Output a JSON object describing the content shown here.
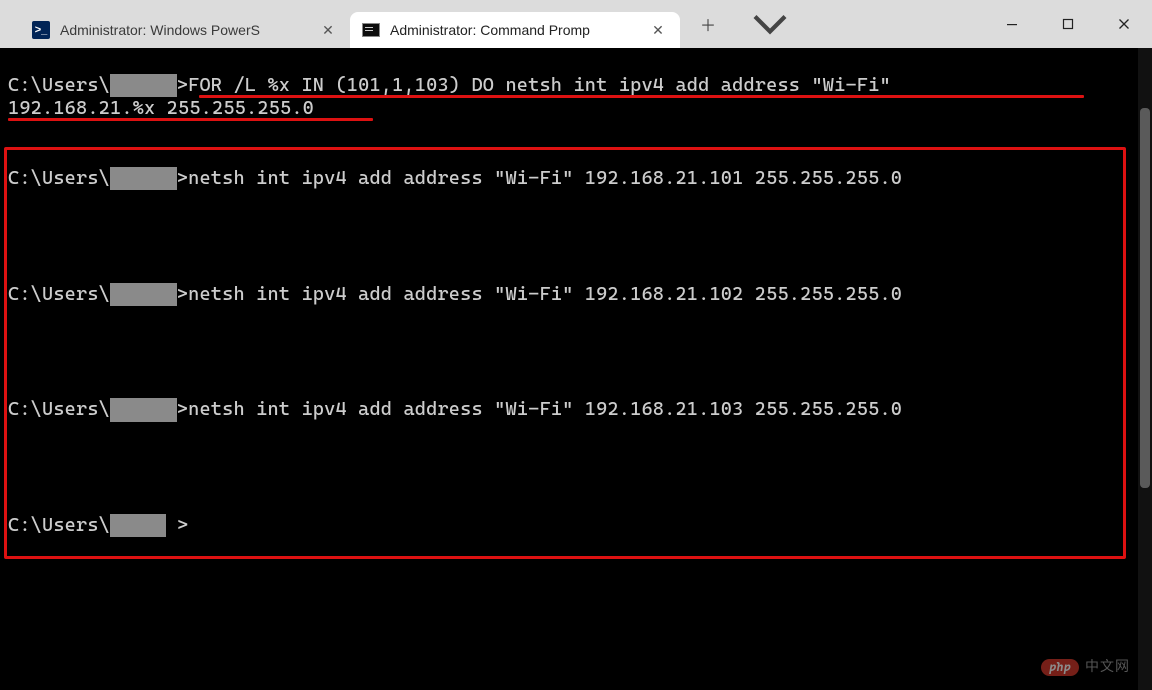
{
  "tabs": [
    {
      "title": "Administrator: Windows PowerS",
      "icon": "powershell",
      "active": false
    },
    {
      "title": "Administrator: Command Promp",
      "icon": "cmd",
      "active": true
    }
  ],
  "prompt_path": "C:\\Users\\",
  "prompt_redacted_len": 6,
  "prompt_suffix": ">",
  "main_command_line1": "FOR /L %x IN (101,1,103) DO netsh int ipv4 add address \"Wi-Fi\"",
  "main_command_line2": "192.168.21.%x 255.255.255.0",
  "iterations": [
    "netsh int ipv4 add address \"Wi-Fi\" 192.168.21.101 255.255.255.0",
    "netsh int ipv4 add address \"Wi-Fi\" 192.168.21.102 255.255.255.0",
    "netsh int ipv4 add address \"Wi-Fi\" 192.168.21.103 255.255.255.0"
  ],
  "watermark": {
    "badge": "php",
    "text": "中文网"
  },
  "colors": {
    "bg": "#000000",
    "fg": "#cccccc",
    "annotation": "#d11"
  }
}
